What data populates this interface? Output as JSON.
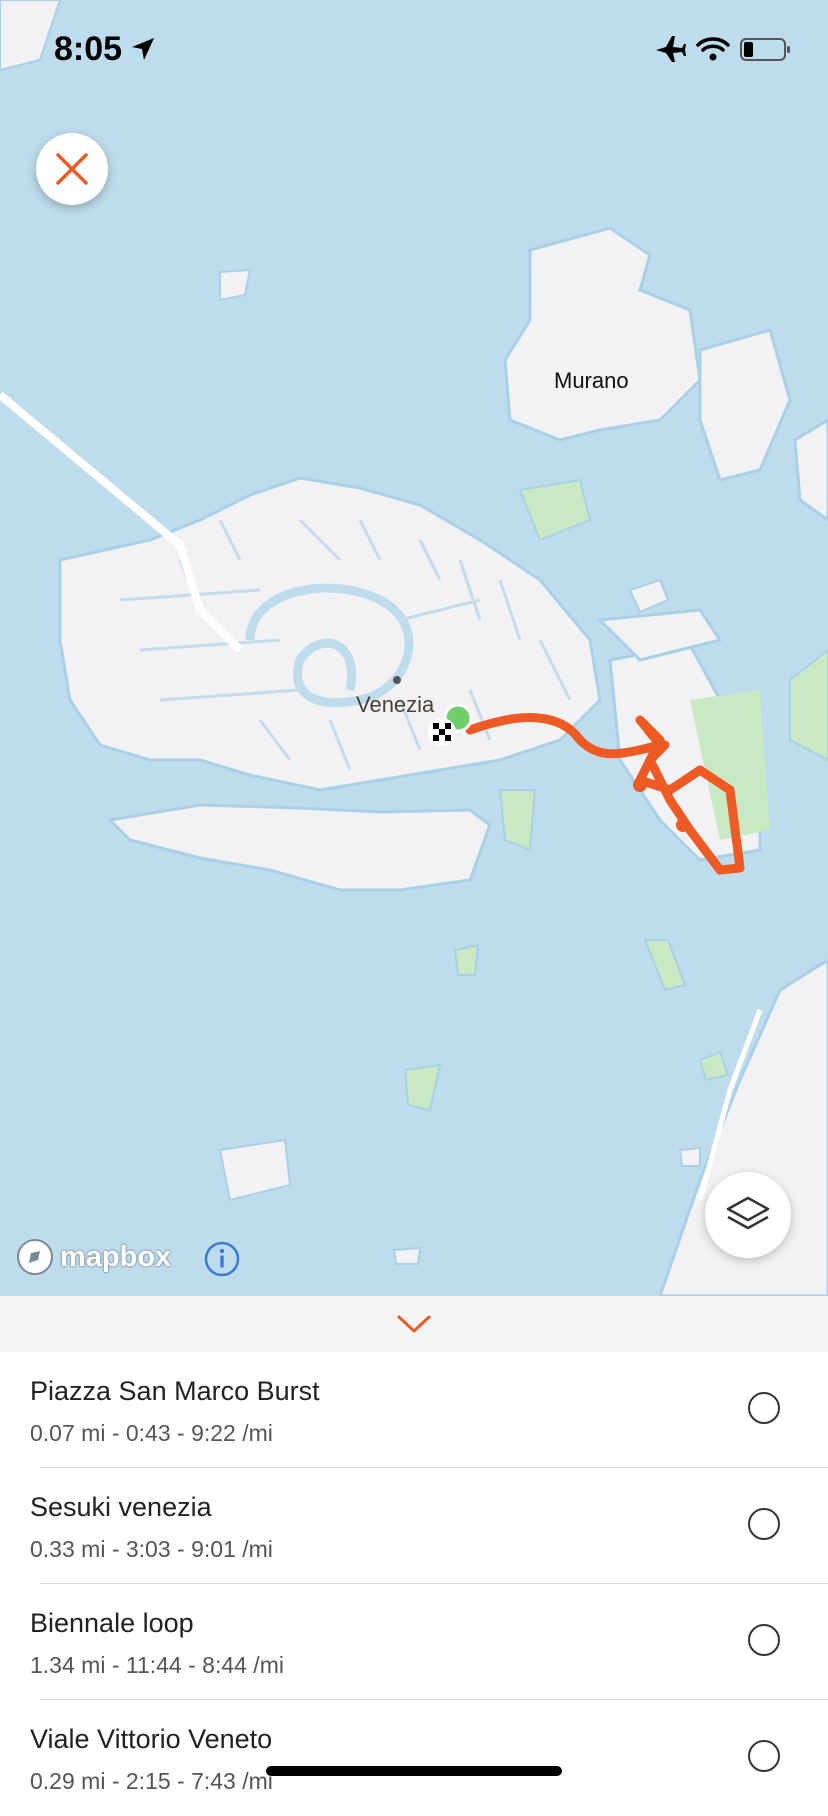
{
  "status_bar": {
    "time": "8:05"
  },
  "map": {
    "labels": {
      "murano": "Murano",
      "venezia": "Venezia"
    },
    "attribution": "mapbox",
    "route_color": "#ee5a24",
    "water_color": "#bfdcec",
    "land_color": "#f2f2f4",
    "park_color": "#c9e8c4"
  },
  "icons": {
    "close": "close-icon",
    "layers": "layers-icon",
    "info": "info-icon",
    "collapse": "chevron-down-icon",
    "finish": "checkered-flag-icon",
    "start": "start-marker-icon"
  },
  "activities": [
    {
      "title": "Piazza San Marco Burst",
      "meta": "0.07 mi - 0:43 - 9:22 /mi"
    },
    {
      "title": "Sesuki venezia",
      "meta": "0.33 mi - 3:03 - 9:01 /mi"
    },
    {
      "title": "Biennale loop",
      "meta": "1.34 mi - 11:44 - 8:44 /mi"
    },
    {
      "title": "Viale Vittorio Veneto",
      "meta": "0.29 mi - 2:15 - 7:43 /mi"
    }
  ]
}
